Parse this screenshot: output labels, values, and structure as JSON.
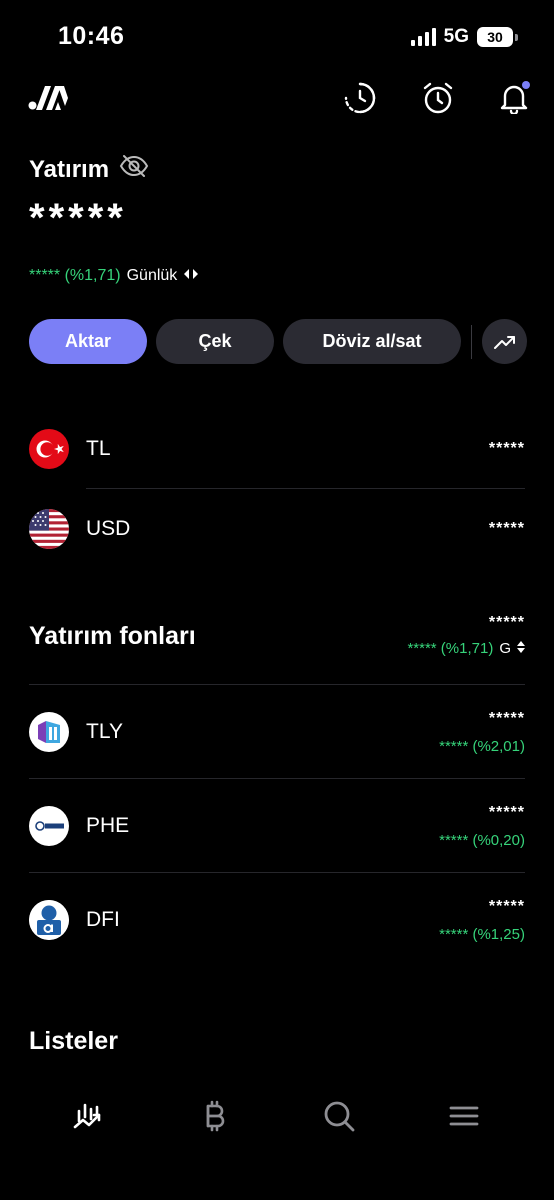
{
  "status_bar": {
    "time": "10:46",
    "network": "5G",
    "battery": "30"
  },
  "header": {
    "title": "Yatırım",
    "hidden_amount": "*****",
    "daily_change": "***** (%1,71)",
    "daily_label": "Günlük"
  },
  "actions": {
    "transfer": "Aktar",
    "withdraw": "Çek",
    "exchange": "Döviz al/sat"
  },
  "currencies": [
    {
      "label": "TL",
      "value": "*****"
    },
    {
      "label": "USD",
      "value": "*****"
    }
  ],
  "funds": {
    "title": "Yatırım fonları",
    "total": "*****",
    "total_change": "***** (%1,71)",
    "period": "G",
    "items": [
      {
        "label": "TLY",
        "value": "*****",
        "change": "***** (%2,01)"
      },
      {
        "label": "PHE",
        "value": "*****",
        "change": "***** (%0,20)"
      },
      {
        "label": "DFI",
        "value": "*****",
        "change": "***** (%1,25)"
      }
    ]
  },
  "lists": {
    "title": "Listeler"
  },
  "colors": {
    "accent": "#7b7ff6",
    "positive": "#36d37a",
    "button_bg": "#2b2b33",
    "background": "#000000"
  },
  "icons": [
    "history-icon",
    "alarm-icon",
    "bell-icon",
    "eye-off-icon",
    "chart-trend-icon",
    "bitcoin-icon",
    "search-icon",
    "menu-icon"
  ]
}
